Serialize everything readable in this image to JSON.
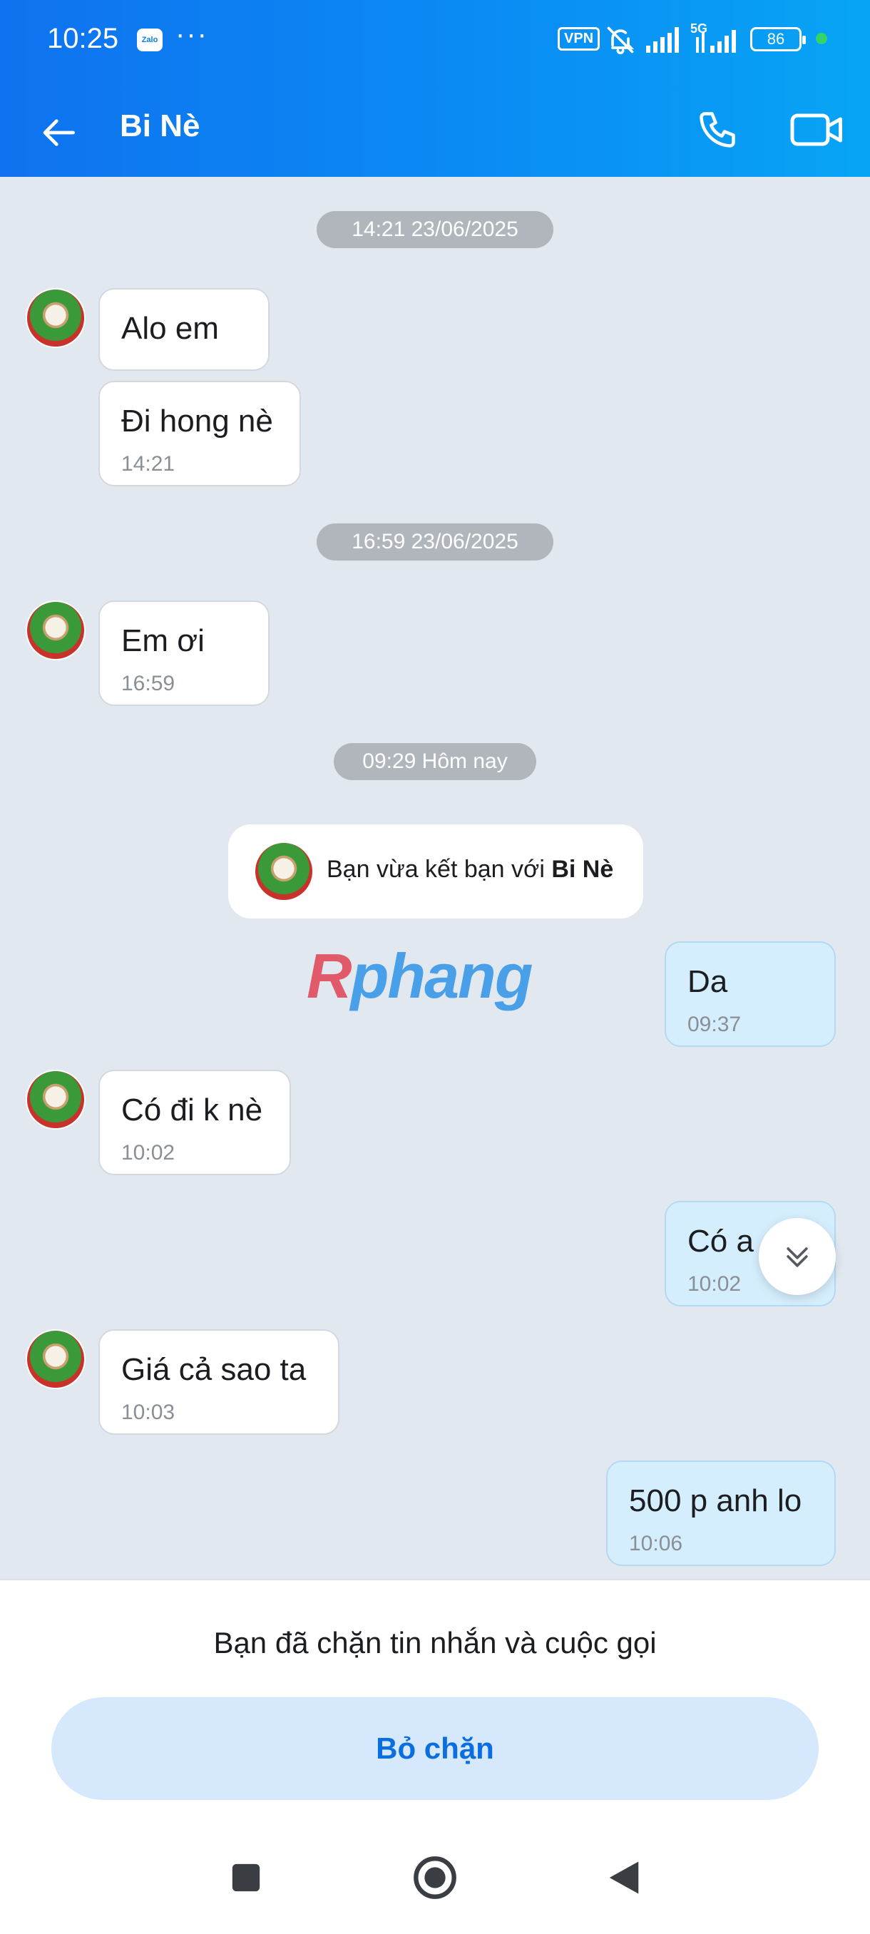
{
  "status_bar": {
    "time": "10:25",
    "app_badge": "Zalo",
    "more": "···",
    "vpn": "VPN",
    "network": "5G",
    "battery": "86"
  },
  "header": {
    "title": "Bi Nè",
    "icons": [
      "back-arrow-icon",
      "phone-icon",
      "video-camera-icon"
    ]
  },
  "chat": {
    "date_separators": [
      "14:21 23/06/2025",
      "16:59 23/06/2025",
      "09:29 Hôm nay"
    ],
    "messages": [
      {
        "side": "in",
        "text": "Alo em",
        "time": ""
      },
      {
        "side": "in",
        "text": "Đi hong nè",
        "time": "14:21"
      },
      {
        "side": "in",
        "text": "Em ơi",
        "time": "16:59"
      },
      {
        "side": "out",
        "text": "Da",
        "time": "09:37"
      },
      {
        "side": "in",
        "text": "Có đi k nè",
        "time": "10:02"
      },
      {
        "side": "out",
        "text": "Có a",
        "time": "10:02"
      },
      {
        "side": "in",
        "text": "Giá cả sao ta",
        "time": "10:03"
      },
      {
        "side": "out",
        "text": "500 p anh lo",
        "time": "10:06"
      }
    ],
    "friend_notice": {
      "prefix": "Bạn vừa kết bạn với ",
      "name": "Bi Nè"
    },
    "watermark": {
      "first": "R",
      "rest": "phang"
    }
  },
  "block_panel": {
    "message": "Bạn đã chặn tin nhắn và cuộc gọi",
    "unblock_label": "Bỏ chặn"
  },
  "colors": {
    "header_start": "#0f72f0",
    "header_end": "#07a4f5",
    "chat_bg": "#e2e8f0",
    "outgoing_bubble": "#d5eefd",
    "unblock_button_bg": "#d6e8fb",
    "unblock_button_text": "#0b6ee0"
  }
}
